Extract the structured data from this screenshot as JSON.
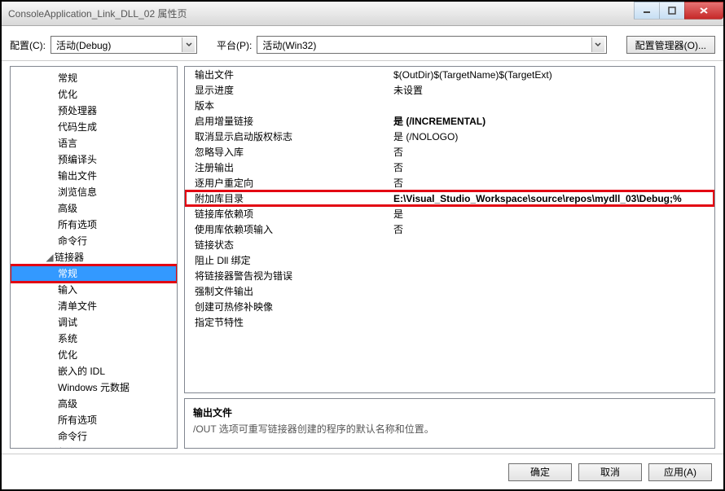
{
  "window": {
    "title": "ConsoleApplication_Link_DLL_02 属性页"
  },
  "toolbar": {
    "config_label": "配置(C):",
    "config_value": "活动(Debug)",
    "platform_label": "平台(P):",
    "platform_value": "活动(Win32)",
    "config_mgr_label": "配置管理器(O)..."
  },
  "tree": {
    "items_top": [
      {
        "label": "常规"
      },
      {
        "label": "优化"
      },
      {
        "label": "预处理器"
      },
      {
        "label": "代码生成"
      },
      {
        "label": "语言"
      },
      {
        "label": "预编译头"
      },
      {
        "label": "输出文件"
      },
      {
        "label": "浏览信息"
      },
      {
        "label": "高级"
      },
      {
        "label": "所有选项"
      },
      {
        "label": "命令行"
      }
    ],
    "linker_label": "链接器",
    "items_linker": [
      {
        "label": "常规",
        "selected": true
      },
      {
        "label": "输入"
      },
      {
        "label": "清单文件"
      },
      {
        "label": "调试"
      },
      {
        "label": "系统"
      },
      {
        "label": "优化"
      },
      {
        "label": "嵌入的 IDL"
      },
      {
        "label": "Windows 元数据"
      },
      {
        "label": "高级"
      },
      {
        "label": "所有选项"
      },
      {
        "label": "命令行"
      }
    ],
    "manifest_label": "清单工具"
  },
  "props": [
    {
      "name": "输出文件",
      "value": "$(OutDir)$(TargetName)$(TargetExt)"
    },
    {
      "name": "显示进度",
      "value": "未设置"
    },
    {
      "name": "版本",
      "value": ""
    },
    {
      "name": "启用增量链接",
      "value": "是 (/INCREMENTAL)",
      "bold": true
    },
    {
      "name": "取消显示启动版权标志",
      "value": "是 (/NOLOGO)"
    },
    {
      "name": "忽略导入库",
      "value": "否"
    },
    {
      "name": "注册输出",
      "value": "否"
    },
    {
      "name": "逐用户重定向",
      "value": "否"
    },
    {
      "name": "附加库目录",
      "value": "E:\\Visual_Studio_Workspace\\source\\repos\\mydll_03\\Debug;%",
      "bold": true,
      "highlight": true
    },
    {
      "name": "链接库依赖项",
      "value": "是"
    },
    {
      "name": "使用库依赖项输入",
      "value": "否"
    },
    {
      "name": "链接状态",
      "value": ""
    },
    {
      "name": "阻止 Dll 绑定",
      "value": ""
    },
    {
      "name": "将链接器警告视为错误",
      "value": ""
    },
    {
      "name": "强制文件输出",
      "value": ""
    },
    {
      "name": "创建可热修补映像",
      "value": ""
    },
    {
      "name": "指定节特性",
      "value": ""
    }
  ],
  "desc": {
    "title": "输出文件",
    "text": "/OUT 选项可重写链接器创建的程序的默认名称和位置。"
  },
  "footer": {
    "ok": "确定",
    "cancel": "取消",
    "apply": "应用(A)"
  }
}
